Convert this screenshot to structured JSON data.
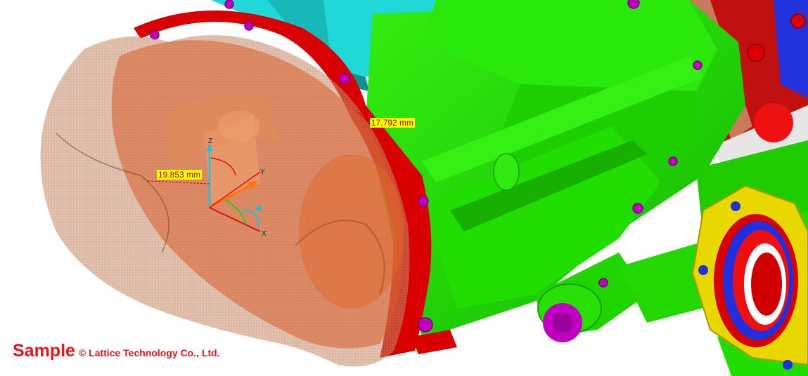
{
  "viewer": {
    "measurements": [
      {
        "label": "17.792 mm"
      },
      {
        "label": "19.853 mm"
      }
    ],
    "axes": {
      "x": "X",
      "y": "Y",
      "z": "Z"
    },
    "watermark": {
      "sample": "Sample",
      "copyright": "© Lattice Technology Co., Ltd."
    },
    "colors": {
      "housing": "#22dd00",
      "flange": "#d80000",
      "bracket": "#20d8d8",
      "bolt": "#c000c0",
      "ghost_part": "#c87850",
      "bearing_ring": "#2030e0",
      "gasket": "#e8d800",
      "label_bg": "#ffff00",
      "label_text": "#b00000",
      "watermark": "#e8141c"
    }
  }
}
